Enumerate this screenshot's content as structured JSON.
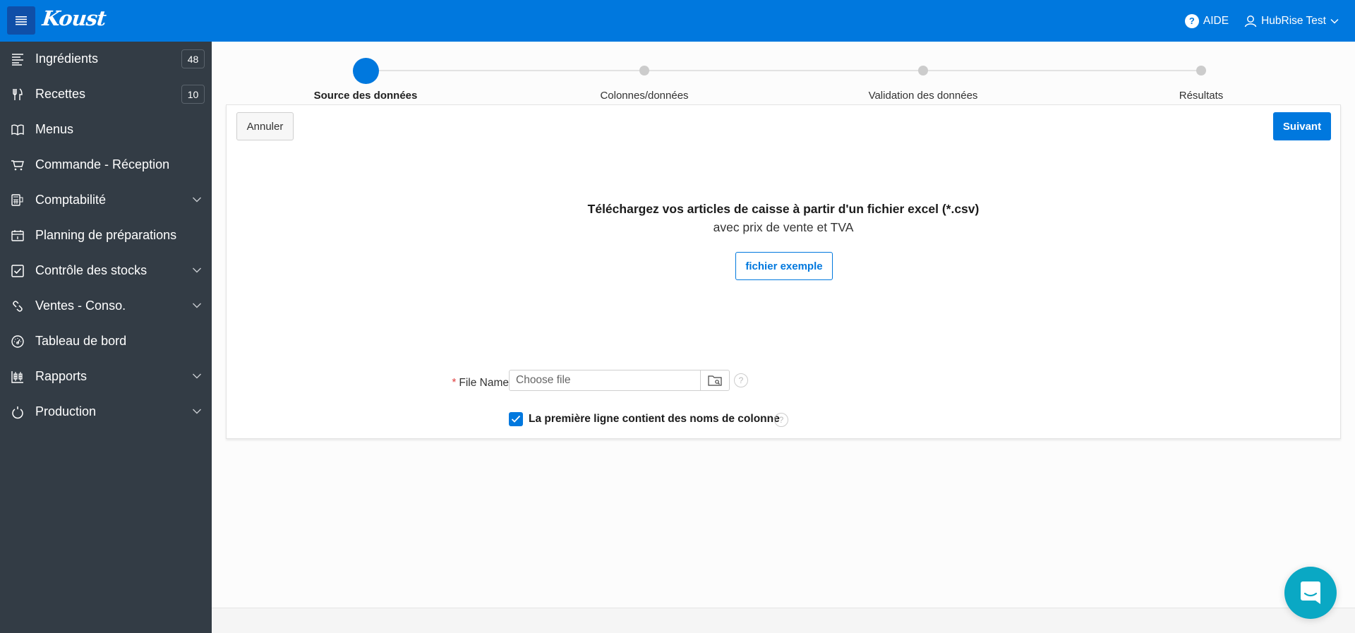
{
  "header": {
    "logo": "Koust",
    "help_label": "AIDE",
    "user_label": "HubRise Test",
    "brand_color": "#0078de"
  },
  "sidebar": {
    "items": [
      {
        "label": "Ingrédients",
        "icon": "list-icon",
        "badge": "48",
        "expandable": false
      },
      {
        "label": "Recettes",
        "icon": "utensils-icon",
        "badge": "10",
        "expandable": false
      },
      {
        "label": "Menus",
        "icon": "book-icon",
        "badge": null,
        "expandable": false
      },
      {
        "label": "Commande - Réception",
        "icon": "cart-icon",
        "badge": null,
        "expandable": false
      },
      {
        "label": "Comptabilité",
        "icon": "calculator-icon",
        "badge": null,
        "expandable": true
      },
      {
        "label": "Planning de préparations",
        "icon": "calendar-icon",
        "badge": null,
        "expandable": false
      },
      {
        "label": "Contrôle des stocks",
        "icon": "checkbox-icon",
        "badge": null,
        "expandable": true
      },
      {
        "label": "Ventes - Conso.",
        "icon": "link-icon",
        "badge": null,
        "expandable": true
      },
      {
        "label": "Tableau de bord",
        "icon": "gauge-icon",
        "badge": null,
        "expandable": false
      },
      {
        "label": "Rapports",
        "icon": "report-icon",
        "badge": null,
        "expandable": true
      },
      {
        "label": "Production",
        "icon": "power-icon",
        "badge": null,
        "expandable": true
      }
    ]
  },
  "stepper": {
    "steps": [
      {
        "label": "Source des données",
        "active": true
      },
      {
        "label": "Colonnes/données",
        "active": false
      },
      {
        "label": "Validation des données",
        "active": false
      },
      {
        "label": "Résultats",
        "active": false
      }
    ]
  },
  "card": {
    "cancel_label": "Annuler",
    "next_label": "Suivant",
    "upload_title": "Téléchargez vos articles de caisse à partir d'un fichier excel (*.csv)",
    "upload_subtitle": "avec prix de vente et TVA",
    "example_label": "fichier exemple",
    "file_field": {
      "required_mark": "*",
      "label": "File Name",
      "placeholder": "Choose file",
      "value": ""
    },
    "header_checkbox": {
      "label": "La première ligne contient des noms de colonne",
      "checked": true
    }
  }
}
